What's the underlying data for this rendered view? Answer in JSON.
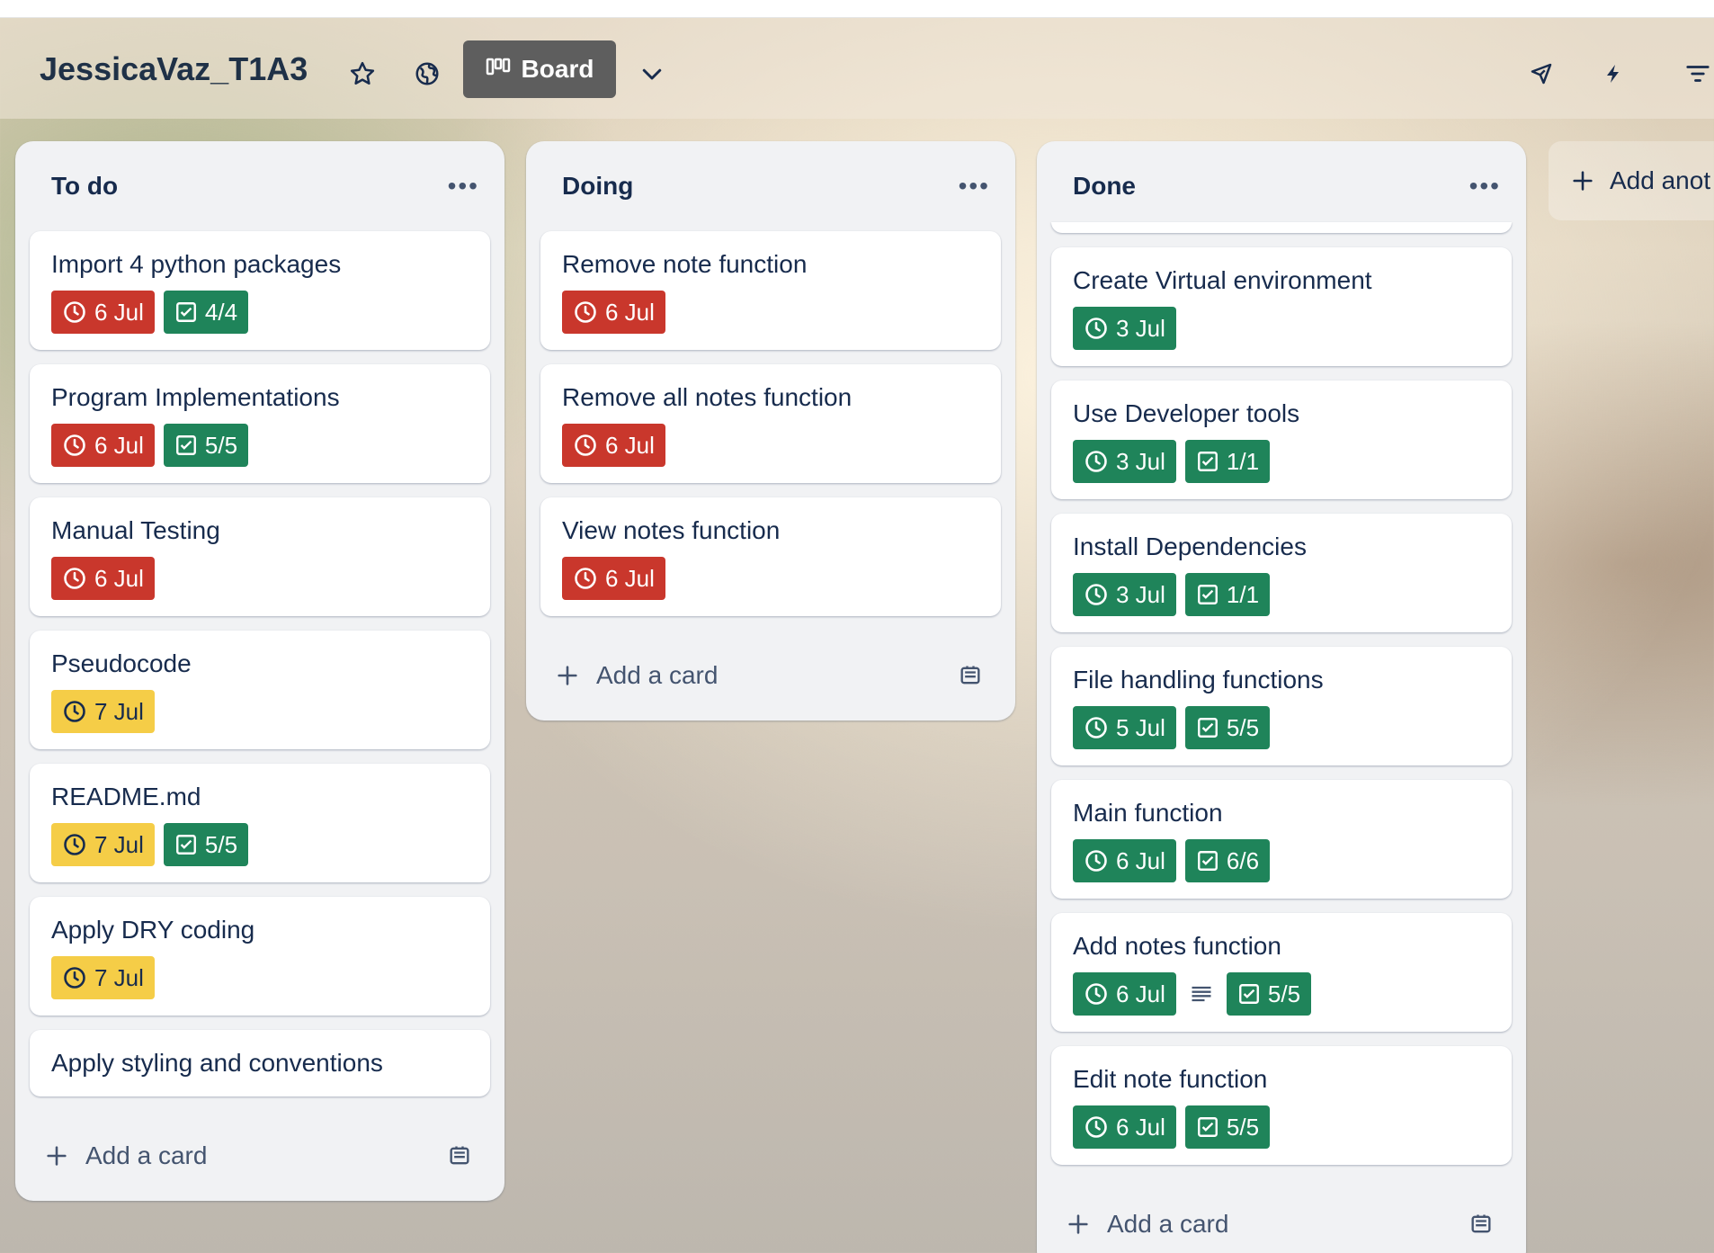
{
  "board": {
    "title": "JessicaVaz_T1A3",
    "view_label": "Board"
  },
  "icons": {
    "star": "star-icon",
    "visibility": "globe-icon",
    "board_view": "board-columns-icon",
    "dropdown": "chevron-down-icon",
    "power_ups": "rocket-icon",
    "automation": "lightning-icon",
    "filter": "filter-icon",
    "clock": "clock-icon",
    "checklist": "checkbox-icon",
    "description": "description-icon",
    "plus": "plus-icon",
    "template": "card-template-icon",
    "menu": "more-dots-icon"
  },
  "colors": {
    "overdue": "#c9372c",
    "due_soon": "#f5cd47",
    "complete": "#1f845a"
  },
  "add_card_label": "Add a card",
  "add_list_label": "Add anot",
  "lists": [
    {
      "title": "To do",
      "menu": "•••",
      "cards": [
        {
          "title": "Import 4 python packages",
          "due": "6 Jul",
          "due_status": "red",
          "checklist": "4/4"
        },
        {
          "title": "Program Implementations",
          "due": "6 Jul",
          "due_status": "red",
          "checklist": "5/5"
        },
        {
          "title": "Manual Testing",
          "due": "6 Jul",
          "due_status": "red"
        },
        {
          "title": "Pseudocode",
          "due": "7 Jul",
          "due_status": "yellow"
        },
        {
          "title": "README.md",
          "due": "7 Jul",
          "due_status": "yellow",
          "checklist": "5/5"
        },
        {
          "title": "Apply DRY coding",
          "due": "7 Jul",
          "due_status": "yellow"
        },
        {
          "title": "Apply styling and conventions"
        }
      ]
    },
    {
      "title": "Doing",
      "menu": "•••",
      "cards": [
        {
          "title": "Remove note function",
          "due": "6 Jul",
          "due_status": "red"
        },
        {
          "title": "Remove all notes function",
          "due": "6 Jul",
          "due_status": "red"
        },
        {
          "title": "View notes function",
          "due": "6 Jul",
          "due_status": "red"
        }
      ]
    },
    {
      "title": "Done",
      "menu": "•••",
      "cards": [
        {
          "title": "Create Virtual environment",
          "due": "3 Jul",
          "due_status": "green"
        },
        {
          "title": "Use Developer tools",
          "due": "3 Jul",
          "due_status": "green",
          "checklist": "1/1"
        },
        {
          "title": "Install Dependencies",
          "due": "3 Jul",
          "due_status": "green",
          "checklist": "1/1"
        },
        {
          "title": "File handling functions",
          "due": "5 Jul",
          "due_status": "green",
          "checklist": "5/5"
        },
        {
          "title": "Main function",
          "due": "6 Jul",
          "due_status": "green",
          "checklist": "6/6"
        },
        {
          "title": "Add notes function",
          "due": "6 Jul",
          "due_status": "green",
          "has_description": true,
          "checklist": "5/5"
        },
        {
          "title": "Edit note function",
          "due": "6 Jul",
          "due_status": "green",
          "checklist": "5/5"
        }
      ]
    }
  ]
}
